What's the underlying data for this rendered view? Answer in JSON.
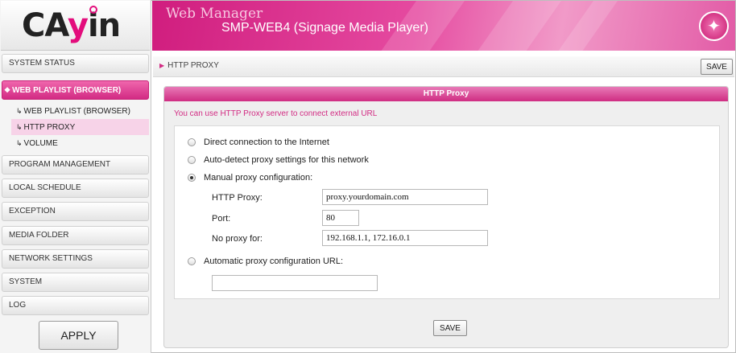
{
  "brand": {
    "logo_text_pre": "CA",
    "logo_text_y": "y",
    "logo_text_post": "in"
  },
  "header": {
    "app_name": "Web Manager",
    "model": "SMP-WEB4 (Signage Media Player)"
  },
  "sidebar": {
    "items": [
      {
        "label": "SYSTEM STATUS"
      },
      {
        "label": "WEB PLAYLIST (BROWSER)"
      },
      {
        "label": "PROGRAM MANAGEMENT"
      },
      {
        "label": "LOCAL SCHEDULE"
      },
      {
        "label": "EXCEPTION"
      },
      {
        "label": "MEDIA FOLDER"
      },
      {
        "label": "NETWORK SETTINGS"
      },
      {
        "label": "SYSTEM"
      },
      {
        "label": "LOG"
      }
    ],
    "sub_items": [
      {
        "label": "WEB PLAYLIST (BROWSER)"
      },
      {
        "label": "HTTP PROXY"
      },
      {
        "label": "VOLUME"
      }
    ],
    "apply_label": "APPLY"
  },
  "titlebar": {
    "title": "HTTP PROXY",
    "save_label": "SAVE"
  },
  "panel": {
    "heading": "HTTP Proxy",
    "hint": "You can use HTTP Proxy server to connect external URL",
    "options": {
      "direct": "Direct connection to the Internet",
      "auto_detect": "Auto-detect proxy settings for this network",
      "manual": "Manual proxy configuration:",
      "auto_url": "Automatic proxy configuration URL:"
    },
    "selected_option": "manual",
    "fields": {
      "http_proxy_label": "HTTP Proxy:",
      "http_proxy_value": "proxy.yourdomain.com",
      "port_label": "Port:",
      "port_value": "80",
      "no_proxy_label": "No proxy for:",
      "no_proxy_value": "192.168.1.1, 172.16.0.1",
      "auto_url_value": ""
    },
    "save_label": "SAVE"
  },
  "colors": {
    "accent": "#d22b83",
    "accent_light": "#f7d3e8"
  }
}
